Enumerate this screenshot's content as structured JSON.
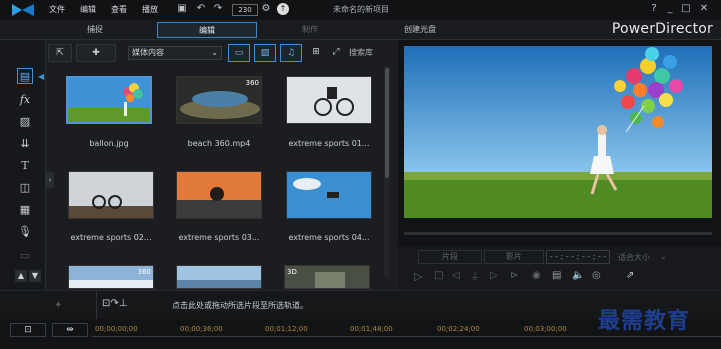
{
  "titlebar": {
    "menus": [
      "文件",
      "编辑",
      "查看",
      "播放"
    ],
    "zoom": "230",
    "project_title": "未命名的新项目",
    "help": "?",
    "minimize": "_",
    "maximize": "□",
    "close": "✕"
  },
  "tabs": [
    {
      "label": "捕捉"
    },
    {
      "label": "编辑"
    },
    {
      "label": "制作"
    },
    {
      "label": "创建光盘"
    }
  ],
  "brand": "PowerDirector",
  "library": {
    "dropdown": "媒体内容",
    "search": "搜索库",
    "items": [
      {
        "name": "ballon.jpg"
      },
      {
        "name": "beach 360.mp4",
        "badge": "360"
      },
      {
        "name": "extreme sports 01..."
      },
      {
        "name": "extreme sports 02..."
      },
      {
        "name": "extreme sports 03..."
      },
      {
        "name": "extreme sports 04..."
      },
      {
        "name": "",
        "badge": "360"
      },
      {
        "name": ""
      },
      {
        "name": "",
        "badge": "3D"
      }
    ]
  },
  "preview": {
    "btn_clip": "片段",
    "btn_movie": "影片",
    "timecode": "- - ; - - ; - - ; - -",
    "size_label": "适合大小"
  },
  "bottom": {
    "hint": "点击此处或拖动所选片段至所选轨道。"
  },
  "timeline": {
    "times": [
      "00;00;00;00",
      "00;00;36;00",
      "00;01;12;00",
      "00;01;48;00",
      "00;02;24;00",
      "00;03;00;00"
    ]
  },
  "watermark": "最需教育",
  "colors": {
    "accent": "#3b86c4",
    "timecode": "#b08a3a",
    "watermark": "#1e3e8e"
  }
}
